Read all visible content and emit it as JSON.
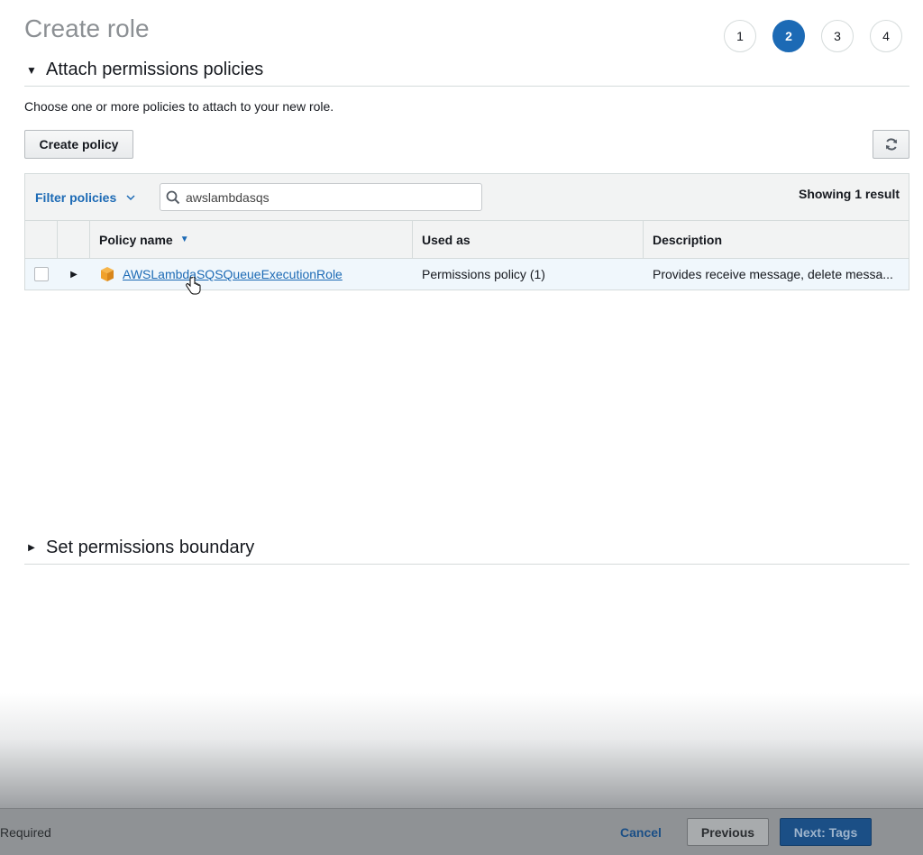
{
  "header": {
    "title": "Create role",
    "steps": [
      "1",
      "2",
      "3",
      "4"
    ],
    "active_step": "2"
  },
  "attach_section": {
    "title": "Attach permissions policies",
    "expanded": true,
    "description": "Choose one or more policies to attach to your new role.",
    "create_policy_label": "Create policy",
    "refresh_icon": "refresh-icon"
  },
  "filter": {
    "label": "Filter policies",
    "search_value": "awslambdasqs",
    "result_text": "Showing 1 result"
  },
  "table": {
    "columns": [
      "Policy name",
      "Used as",
      "Description"
    ],
    "sort_column": "Policy name",
    "rows": [
      {
        "checked": false,
        "name": "AWSLambdaSQSQueueExecutionRole",
        "used_as": "Permissions policy (1)",
        "description": "Provides receive message, delete messa..."
      }
    ]
  },
  "boundary_section": {
    "title": "Set permissions boundary",
    "expanded": false
  },
  "footer": {
    "required": "Required",
    "cancel": "Cancel",
    "previous": "Previous",
    "next": "Next: Tags"
  },
  "colors": {
    "accent": "#1c6ab5",
    "policy_icon": "#f0a12b"
  }
}
